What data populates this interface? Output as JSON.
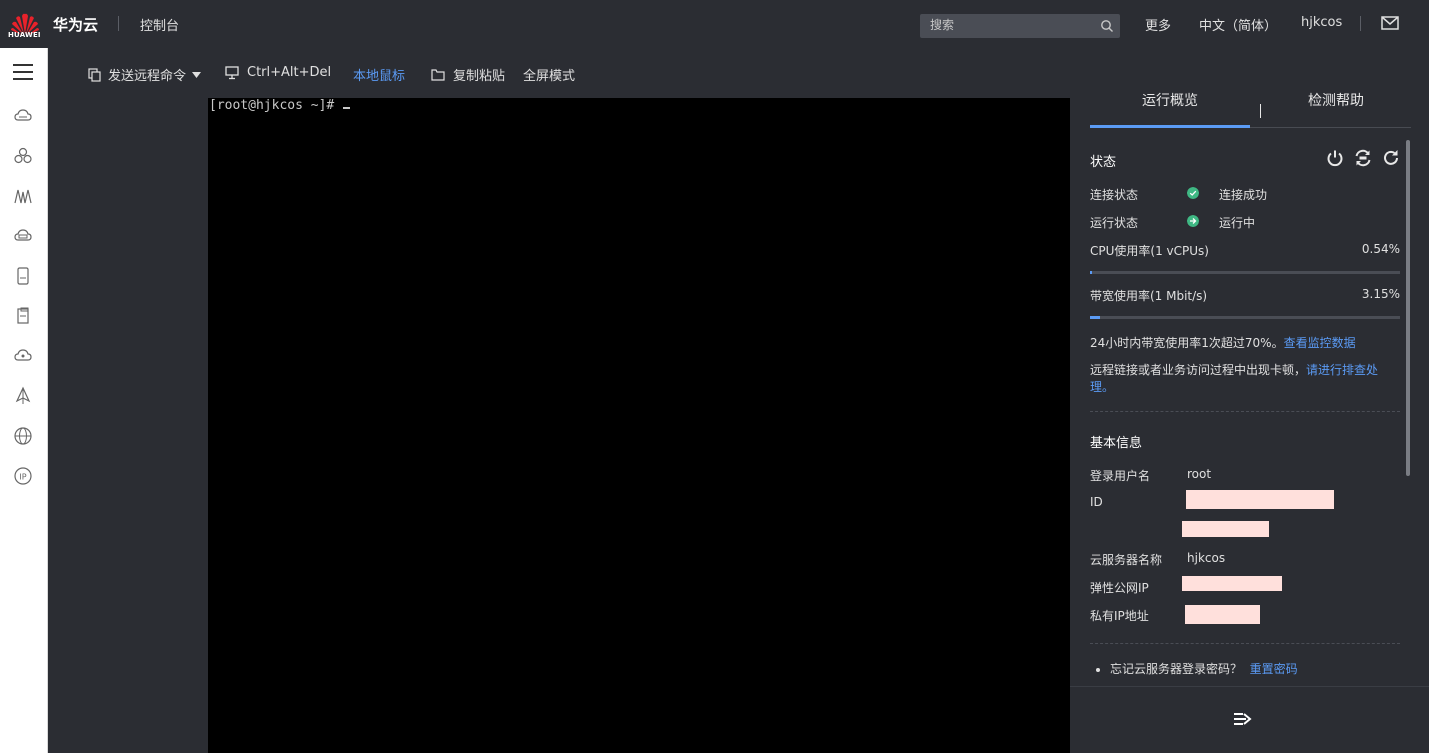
{
  "header": {
    "logo_text": "HUAWEI",
    "brand": "华为云",
    "console": "控制台",
    "search_placeholder": "搜索",
    "more": "更多",
    "language": "中文（简体）",
    "username": "hjkcos"
  },
  "sidenav": {
    "icons": [
      "cloud-server-icon",
      "cluster-icon",
      "network-icon",
      "cloud-db-icon",
      "storage-icon",
      "document-icon",
      "cloud-icon",
      "deploy-icon",
      "globe-icon",
      "ip-icon"
    ]
  },
  "toolbar": {
    "send_remote_command": "发送远程命令",
    "ctrl_alt_del": "Ctrl+Alt+Del",
    "local_mouse": "本地鼠标",
    "copy_paste": "复制粘贴",
    "fullscreen": "全屏模式"
  },
  "terminal": {
    "prompt": "[root@hjkcos ~]# "
  },
  "panel": {
    "tabs": [
      "运行概览",
      "检测帮助"
    ],
    "status_title": "状态",
    "connection_label": "连接状态",
    "connection_value": "连接成功",
    "run_label": "运行状态",
    "run_value": "运行中",
    "cpu_label": "CPU使用率(1 vCPUs)",
    "cpu_value": "0.54%",
    "cpu_fraction": 0.0054,
    "bandwidth_label": "带宽使用率(1 Mbit/s)",
    "bandwidth_value": "3.15%",
    "bandwidth_fraction": 0.0315,
    "notice1_text": "24小时内带宽使用率1次超过70%。",
    "notice1_link": "查看监控数据",
    "notice2_text": "远程链接或者业务访问过程中出现卡顿，",
    "notice2_link": "请进行排查处理。",
    "basic_title": "基本信息",
    "login_user_label": "登录用户名",
    "login_user_value": "root",
    "id_label": "ID",
    "server_name_label": "云服务器名称",
    "server_name_value": "hjkcos",
    "eip_label": "弹性公网IP",
    "private_ip_label": "私有IP地址",
    "forgot_text": "忘记云服务器登录密码？",
    "reset_link": "重置密码"
  },
  "colors": {
    "accent": "#5b9bf5",
    "status_ok": "#3fb884",
    "redaction": "#ffe0dc",
    "header_bg": "#2b2d33"
  }
}
